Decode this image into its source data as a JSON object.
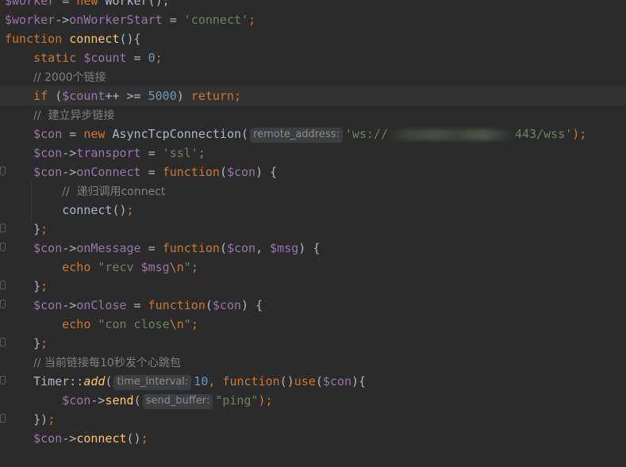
{
  "editor": {
    "language": "php",
    "lines": [
      {
        "tokens": [
          {
            "t": "$worker",
            "c": "var"
          },
          {
            "t": " = ",
            "c": "id"
          },
          {
            "t": "new ",
            "c": "kw"
          },
          {
            "t": "Worker();",
            "c": "id"
          }
        ]
      },
      {
        "tokens": [
          {
            "t": "$worker",
            "c": "var"
          },
          {
            "t": "->",
            "c": "id"
          },
          {
            "t": "onWorkerStart",
            "c": "var"
          },
          {
            "t": " = ",
            "c": "id"
          },
          {
            "t": "'connect'",
            "c": "str"
          },
          {
            "t": ";",
            "c": "kw"
          }
        ]
      },
      {
        "tokens": [
          {
            "t": "function ",
            "c": "kw"
          },
          {
            "t": "connect",
            "c": "fn"
          },
          {
            "t": "(){",
            "c": "id"
          }
        ]
      },
      {
        "tokens": [
          {
            "t": "    ",
            "c": "id"
          },
          {
            "t": "static ",
            "c": "kw"
          },
          {
            "t": "$count",
            "c": "var"
          },
          {
            "t": " = ",
            "c": "id"
          },
          {
            "t": "0",
            "c": "num"
          },
          {
            "t": ";",
            "c": "kw"
          }
        ]
      },
      {
        "tokens": [
          {
            "t": "    ",
            "c": "id"
          },
          {
            "t": "// 2000个链接",
            "c": "cmt"
          }
        ]
      },
      {
        "current": true,
        "tokens": [
          {
            "t": "    ",
            "c": "id"
          },
          {
            "t": "if ",
            "c": "kw"
          },
          {
            "t": "(",
            "c": "id"
          },
          {
            "t": "$count",
            "c": "var"
          },
          {
            "t": "++ >= ",
            "c": "id"
          },
          {
            "t": "5000",
            "c": "num"
          },
          {
            "t": ") ",
            "c": "id"
          },
          {
            "t": "return",
            "c": "kw"
          },
          {
            "t": ";",
            "c": "kw"
          }
        ]
      },
      {
        "tokens": [
          {
            "t": "    ",
            "c": "id"
          },
          {
            "t": "//  建立异步链接",
            "c": "cmt"
          }
        ]
      },
      {
        "tokens": [
          {
            "t": "    ",
            "c": "id"
          },
          {
            "t": "$con",
            "c": "var"
          },
          {
            "t": " = ",
            "c": "id"
          },
          {
            "t": "new ",
            "c": "kw"
          },
          {
            "t": "AsyncTcpConnection(",
            "c": "id"
          },
          {
            "hint": "remote_address:"
          },
          {
            "t": "'ws://",
            "c": "str"
          },
          {
            "blur": true
          },
          {
            "t": "443/wss'",
            "c": "str"
          },
          {
            "t": ");",
            "c": "kw"
          }
        ]
      },
      {
        "tokens": [
          {
            "t": "    ",
            "c": "id"
          },
          {
            "t": "$con",
            "c": "var"
          },
          {
            "t": "->",
            "c": "id"
          },
          {
            "t": "transport",
            "c": "var"
          },
          {
            "t": " = ",
            "c": "id"
          },
          {
            "t": "'ssl'",
            "c": "str"
          },
          {
            "t": ";",
            "c": "kw"
          }
        ]
      },
      {
        "fold": "start",
        "tokens": [
          {
            "t": "    ",
            "c": "id"
          },
          {
            "t": "$con",
            "c": "var"
          },
          {
            "t": "->",
            "c": "id"
          },
          {
            "t": "onConnect",
            "c": "var"
          },
          {
            "t": " = ",
            "c": "id"
          },
          {
            "t": "function",
            "c": "kw"
          },
          {
            "t": "(",
            "c": "id"
          },
          {
            "t": "$con",
            "c": "var"
          },
          {
            "t": ") {",
            "c": "id"
          }
        ]
      },
      {
        "tokens": [
          {
            "t": "        ",
            "c": "id"
          },
          {
            "t": "//  递归调用connect",
            "c": "cmt"
          }
        ]
      },
      {
        "tokens": [
          {
            "t": "        ",
            "c": "id"
          },
          {
            "t": "connect",
            "c": "id"
          },
          {
            "t": "()",
            "c": "id"
          },
          {
            "t": ";",
            "c": "kw"
          }
        ]
      },
      {
        "fold": "end",
        "tokens": [
          {
            "t": "    ",
            "c": "id"
          },
          {
            "t": "}",
            "c": "id"
          },
          {
            "t": ";",
            "c": "kw"
          }
        ]
      },
      {
        "fold": "start",
        "tokens": [
          {
            "t": "    ",
            "c": "id"
          },
          {
            "t": "$con",
            "c": "var"
          },
          {
            "t": "->",
            "c": "id"
          },
          {
            "t": "onMessage",
            "c": "var"
          },
          {
            "t": " = ",
            "c": "id"
          },
          {
            "t": "function",
            "c": "kw"
          },
          {
            "t": "(",
            "c": "id"
          },
          {
            "t": "$con",
            "c": "var"
          },
          {
            "t": ", ",
            "c": "id"
          },
          {
            "t": "$msg",
            "c": "var"
          },
          {
            "t": ") {",
            "c": "id"
          }
        ]
      },
      {
        "tokens": [
          {
            "t": "        ",
            "c": "id"
          },
          {
            "t": "echo ",
            "c": "kw"
          },
          {
            "t": "\"recv ",
            "c": "str"
          },
          {
            "t": "$msg",
            "c": "var"
          },
          {
            "t": "\\n",
            "c": "kw"
          },
          {
            "t": "\"",
            "c": "str"
          },
          {
            "t": ";",
            "c": "kw"
          }
        ]
      },
      {
        "fold": "end",
        "tokens": [
          {
            "t": "    ",
            "c": "id"
          },
          {
            "t": "}",
            "c": "id"
          },
          {
            "t": ";",
            "c": "kw"
          }
        ]
      },
      {
        "fold": "start",
        "tokens": [
          {
            "t": "    ",
            "c": "id"
          },
          {
            "t": "$con",
            "c": "var"
          },
          {
            "t": "->",
            "c": "id"
          },
          {
            "t": "onClose",
            "c": "var"
          },
          {
            "t": " = ",
            "c": "id"
          },
          {
            "t": "function",
            "c": "kw"
          },
          {
            "t": "(",
            "c": "id"
          },
          {
            "t": "$con",
            "c": "var"
          },
          {
            "t": ") {",
            "c": "id"
          }
        ]
      },
      {
        "tokens": [
          {
            "t": "        ",
            "c": "id"
          },
          {
            "t": "echo ",
            "c": "kw"
          },
          {
            "t": "\"con close",
            "c": "str"
          },
          {
            "t": "\\n",
            "c": "kw"
          },
          {
            "t": "\"",
            "c": "str"
          },
          {
            "t": ";",
            "c": "kw"
          }
        ]
      },
      {
        "fold": "end",
        "tokens": [
          {
            "t": "    ",
            "c": "id"
          },
          {
            "t": "}",
            "c": "id"
          },
          {
            "t": ";",
            "c": "kw"
          }
        ]
      },
      {
        "tokens": [
          {
            "t": "    ",
            "c": "id"
          },
          {
            "t": "// 当前链接每10秒发个心跳包",
            "c": "cmt"
          }
        ]
      },
      {
        "fold": "start",
        "tokens": [
          {
            "t": "    ",
            "c": "id"
          },
          {
            "t": "Timer::",
            "c": "id"
          },
          {
            "t": "add",
            "c": "static-call"
          },
          {
            "t": "(",
            "c": "id"
          },
          {
            "hint": "time_interval:"
          },
          {
            "t": "10",
            "c": "num"
          },
          {
            "t": ", ",
            "c": "kw"
          },
          {
            "t": "function",
            "c": "kw"
          },
          {
            "t": "()",
            "c": "id"
          },
          {
            "t": "use",
            "c": "kw"
          },
          {
            "t": "(",
            "c": "id"
          },
          {
            "t": "$con",
            "c": "var"
          },
          {
            "t": "){",
            "c": "id"
          }
        ]
      },
      {
        "tokens": [
          {
            "t": "        ",
            "c": "id"
          },
          {
            "t": "$con",
            "c": "var"
          },
          {
            "t": "->",
            "c": "id"
          },
          {
            "t": "send",
            "c": "fn"
          },
          {
            "t": "(",
            "c": "id"
          },
          {
            "hint": "send_buffer:"
          },
          {
            "t": "\"ping\"",
            "c": "str"
          },
          {
            "t": ");",
            "c": "kw"
          }
        ]
      },
      {
        "fold": "end",
        "tokens": [
          {
            "t": "    ",
            "c": "id"
          },
          {
            "t": "})",
            "c": "id"
          },
          {
            "t": ";",
            "c": "kw"
          }
        ]
      },
      {
        "tokens": [
          {
            "t": "    ",
            "c": "id"
          },
          {
            "t": "$con",
            "c": "var"
          },
          {
            "t": "->",
            "c": "id"
          },
          {
            "t": "connect",
            "c": "fn"
          },
          {
            "t": "()",
            "c": "id"
          },
          {
            "t": ";",
            "c": "kw"
          }
        ]
      }
    ]
  }
}
